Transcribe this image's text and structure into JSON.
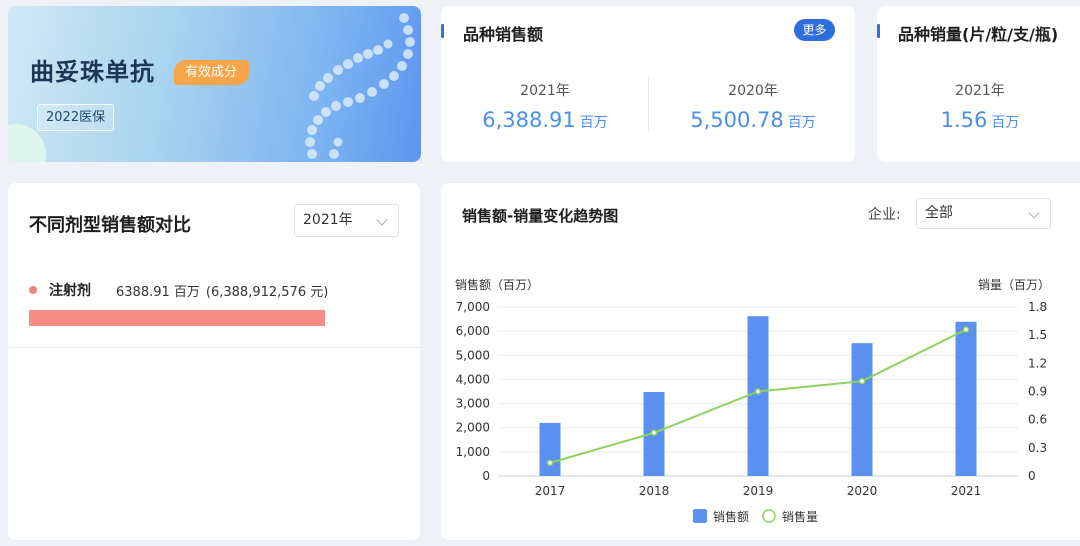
{
  "hero": {
    "title": "曲妥珠单抗",
    "badge": "有效成分",
    "tag": "2022医保"
  },
  "variety_sales": {
    "title": "品种销售额",
    "more_label": "更多",
    "metrics": [
      {
        "year": "2021年",
        "value": "6,388.91",
        "unit": "百万"
      },
      {
        "year": "2020年",
        "value": "5,500.78",
        "unit": "百万"
      }
    ]
  },
  "variety_volume": {
    "title": "品种销量(片/粒/支/瓶)",
    "metrics": [
      {
        "year": "2021年",
        "value": "1.56",
        "unit": "百万"
      }
    ]
  },
  "dosage_compare": {
    "title": "不同剂型销售额对比",
    "year_select": "2021年",
    "items": [
      {
        "name": "注射剂",
        "value": "6388.91 百万",
        "yuan": "(6,388,912,576 元)",
        "share": 1.0
      }
    ]
  },
  "trend": {
    "title": "销售额-销量变化趋势图",
    "filter_label": "企业:",
    "filter_value": "全部",
    "colors": {
      "bar": "#5b8ff0",
      "line": "#8fd15f",
      "grid": "#e9ecf1"
    }
  },
  "chart_data": {
    "type": "bar",
    "categories": [
      "2017",
      "2018",
      "2019",
      "2020",
      "2021"
    ],
    "series": [
      {
        "name": "销售额",
        "type": "bar",
        "axis": "left",
        "values": [
          2200,
          3480,
          6620,
          5500.78,
          6388.91
        ]
      },
      {
        "name": "销售量",
        "type": "line",
        "axis": "right",
        "values": [
          0.14,
          0.46,
          0.9,
          1.01,
          1.56
        ]
      }
    ],
    "ylabel_left": "销售额（百万）",
    "ylabel_right": "销量（百万）",
    "ylim_left": [
      0,
      7000
    ],
    "ylim_right": [
      0,
      1.8
    ],
    "yticks_left": [
      "0",
      "1,000",
      "2,000",
      "3,000",
      "4,000",
      "5,000",
      "6,000",
      "7,000"
    ],
    "yticks_right": [
      "0",
      "0.3",
      "0.6",
      "0.9",
      "1.2",
      "1.5",
      "1.8"
    ],
    "grid": true,
    "legend": "bottom-center"
  }
}
